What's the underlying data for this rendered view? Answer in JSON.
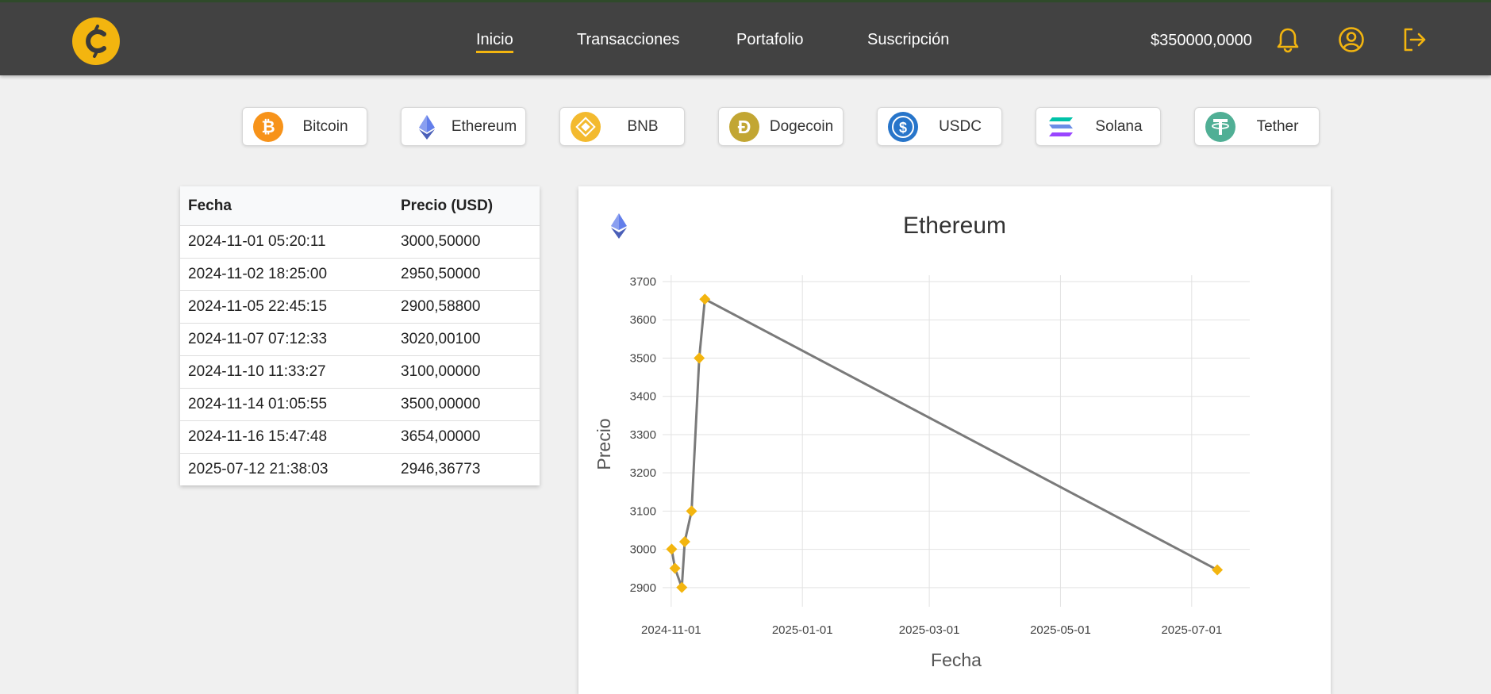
{
  "navbar": {
    "links": [
      {
        "label": "Inicio",
        "active": true
      },
      {
        "label": "Transacciones",
        "active": false
      },
      {
        "label": "Portafolio",
        "active": false
      },
      {
        "label": "Suscripción",
        "active": false
      }
    ],
    "balance": "$350000,0000",
    "icons": [
      "bell-icon",
      "user-circle-icon",
      "logout-icon"
    ],
    "accent_color": "#f3b50f",
    "background_color": "#424242"
  },
  "coins": [
    {
      "label": "Bitcoin",
      "icon": "bitcoin-icon",
      "color": "#f7931a"
    },
    {
      "label": "Ethereum",
      "icon": "ethereum-icon",
      "color": "#627eea"
    },
    {
      "label": "BNB",
      "icon": "bnb-icon",
      "color": "#f3ba2f"
    },
    {
      "label": "Dogecoin",
      "icon": "dogecoin-icon",
      "color": "#c2a633"
    },
    {
      "label": "USDC",
      "icon": "usdc-icon",
      "color": "#2775ca"
    },
    {
      "label": "Solana",
      "icon": "solana-icon",
      "color": "#9945ff"
    },
    {
      "label": "Tether",
      "icon": "tether-icon",
      "color": "#50af95"
    }
  ],
  "table": {
    "headers": [
      "Fecha",
      "Precio (USD)"
    ],
    "rows": [
      [
        "2024-11-01 05:20:11",
        "3000,50000"
      ],
      [
        "2024-11-02 18:25:00",
        "2950,50000"
      ],
      [
        "2024-11-05 22:45:15",
        "2900,58800"
      ],
      [
        "2024-11-07 07:12:33",
        "3020,00100"
      ],
      [
        "2024-11-10 11:33:27",
        "3100,00000"
      ],
      [
        "2024-11-14 01:05:55",
        "3500,00000"
      ],
      [
        "2024-11-16 15:47:48",
        "3654,00000"
      ],
      [
        "2025-07-12 21:38:03",
        "2946,36773"
      ]
    ]
  },
  "chart_data": {
    "type": "line",
    "title": "Ethereum",
    "xlabel": "Fecha",
    "ylabel": "Precio",
    "x": [
      "2024-11-01 05:20:11",
      "2024-11-02 18:25:00",
      "2024-11-05 22:45:15",
      "2024-11-07 07:12:33",
      "2024-11-10 11:33:27",
      "2024-11-14 01:05:55",
      "2024-11-16 15:47:48",
      "2025-07-12 21:38:03"
    ],
    "y": [
      3000.5,
      2950.5,
      2900.588,
      3020.001,
      3100.0,
      3500.0,
      3654.0,
      2946.36773
    ],
    "ylim": [
      2850,
      3700
    ],
    "yticks": [
      2900,
      3000,
      3100,
      3200,
      3300,
      3400,
      3500,
      3600,
      3700
    ],
    "xticks": [
      "2024-11-01",
      "2025-01-01",
      "2025-03-01",
      "2025-05-01",
      "2025-07-01"
    ],
    "xlim": [
      "2024-10-28",
      "2025-07-28"
    ],
    "grid": true,
    "line_color": "#7a7a7a",
    "marker_color": "#f3b50f",
    "marker": "diamond"
  }
}
